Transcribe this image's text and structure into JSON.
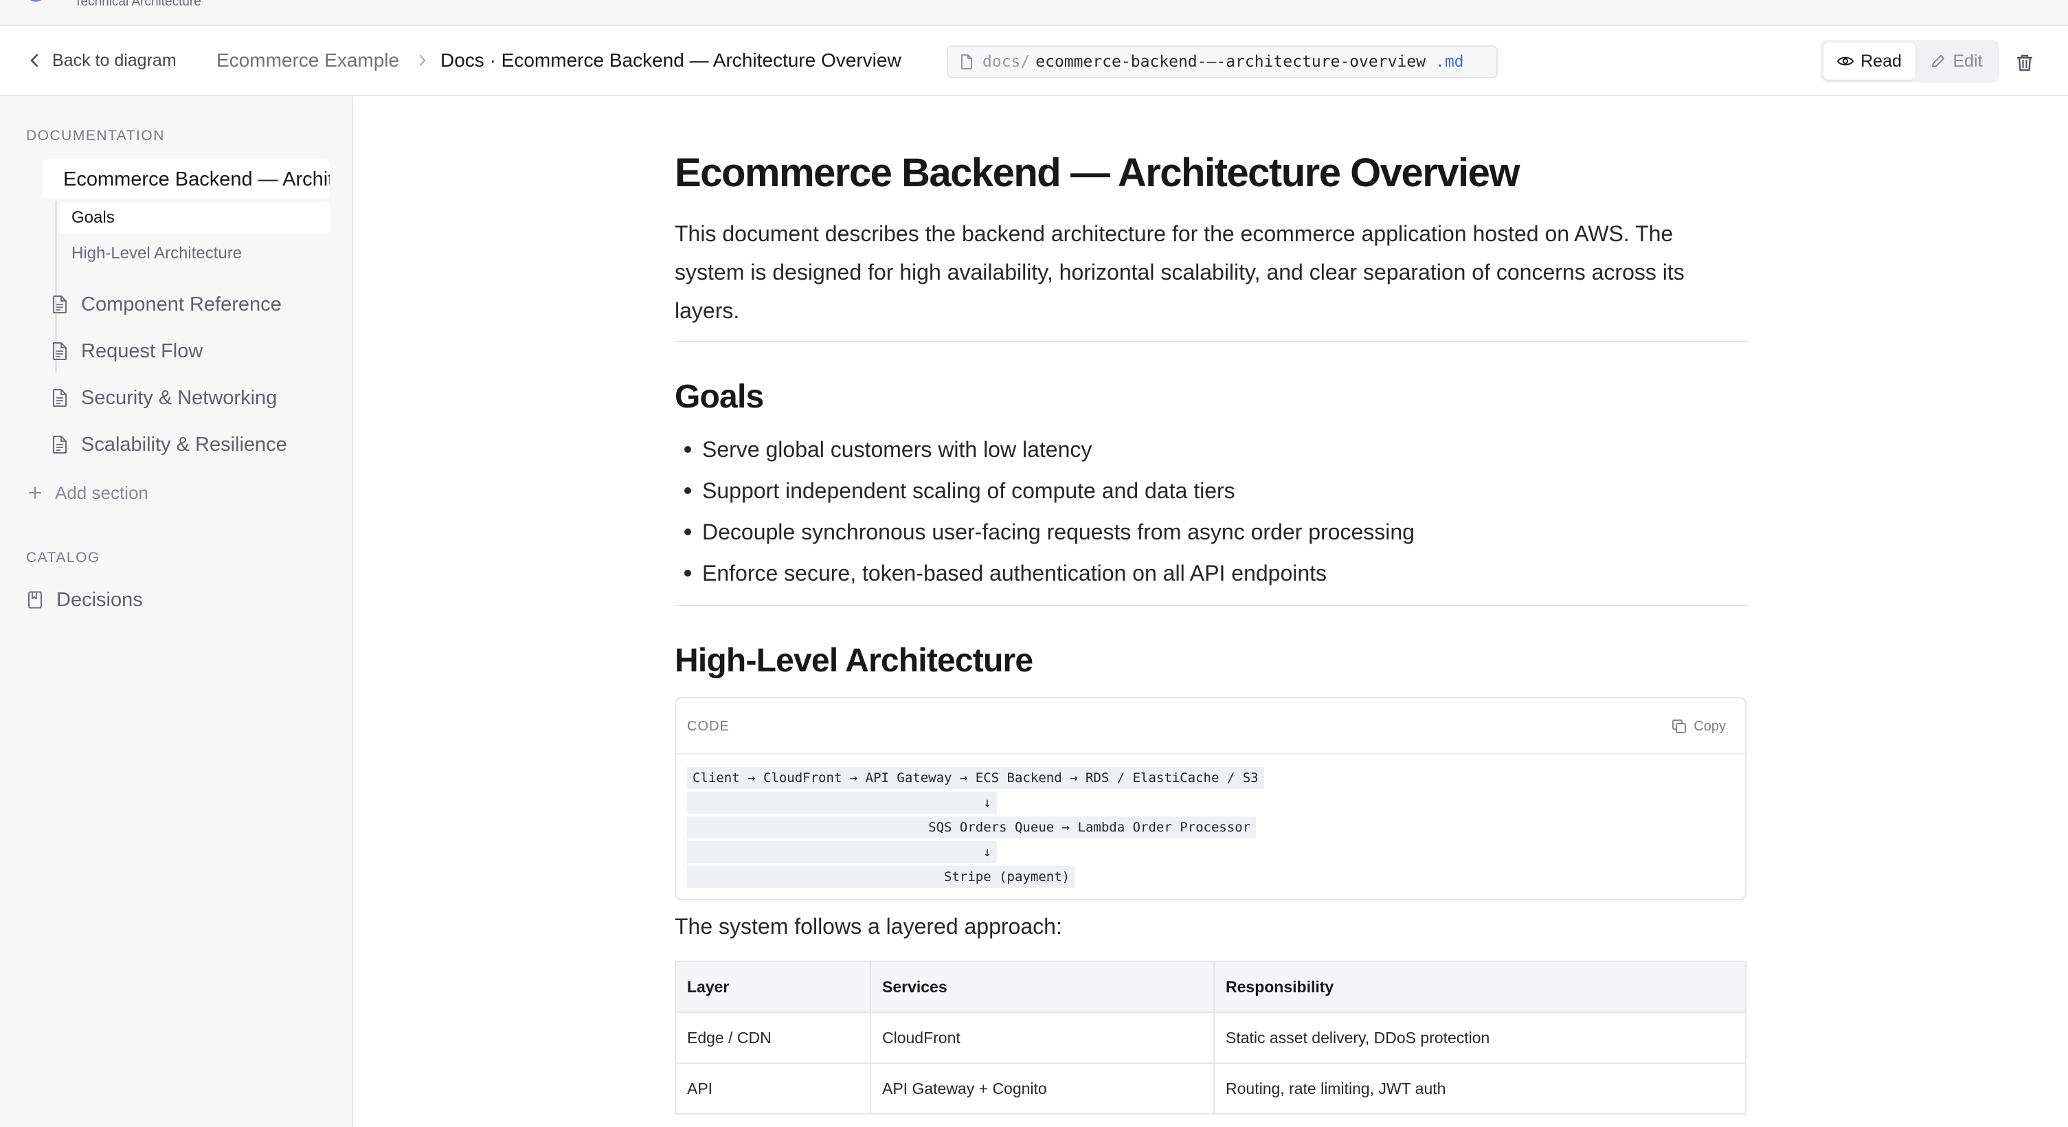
{
  "app": {
    "subtitle": "Technical Architecture"
  },
  "header": {
    "back_label": "Back to diagram",
    "breadcrumb_project": "Ecommerce Example",
    "breadcrumb_doc": "Docs · Ecommerce Backend — Architecture Overview",
    "path_prefix": "docs/",
    "path_slug": "ecommerce-backend-—-architecture-overview",
    "path_ext": ".md",
    "read_label": "Read",
    "edit_label": "Edit",
    "active_mode": "Read"
  },
  "sidebar": {
    "documentation_heading": "DOCUMENTATION",
    "active_doc": "Ecommerce Backend — Architecture Overview",
    "active_subsections": [
      "Goals",
      "High-Level Architecture"
    ],
    "docs": [
      "Component Reference",
      "Request Flow",
      "Security & Networking",
      "Scalability & Resilience"
    ],
    "add_section_label": "Add section",
    "catalog_heading": "CATALOG",
    "catalog_items": [
      "Decisions"
    ]
  },
  "document": {
    "title": "Ecommerce Backend — Architecture Overview",
    "intro": "This document describes the backend architecture for the ecommerce application hosted on AWS. The system is designed for high availability, horizontal scalability, and clear separation of concerns across its layers.",
    "goals_heading": "Goals",
    "goals": [
      "Serve global customers with low latency",
      "Support independent scaling of compute and data tiers",
      "Decouple synchronous user-facing requests from async order processing",
      "Enforce secure, token-based authentication on all API endpoints"
    ],
    "architecture_heading": "High-Level Architecture",
    "code_block": {
      "language_label": "CODE",
      "copy_label": "Copy",
      "lines": [
        "Client → CloudFront → API Gateway → ECS Backend → RDS / ElastiCache / S3",
        "                                     ↓",
        "                              SQS Orders Queue → Lambda Order Processor",
        "                                     ↓",
        "                                Stripe (payment)"
      ]
    },
    "layer_intro": "The system follows a layered approach:",
    "table": {
      "columns": [
        "Layer",
        "Services",
        "Responsibility"
      ],
      "rows": [
        [
          "Edge / CDN",
          "CloudFront",
          "Static asset delivery, DDoS protection"
        ],
        [
          "API",
          "API Gateway + Cognito",
          "Routing, rate limiting, JWT auth"
        ]
      ]
    }
  }
}
